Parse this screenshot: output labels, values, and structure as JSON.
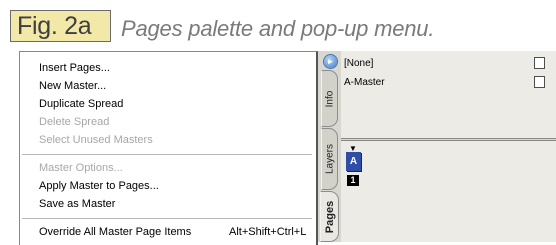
{
  "figure": {
    "tag": "Fig. 2a",
    "caption": "Pages palette and pop-up menu."
  },
  "menu": {
    "items": [
      {
        "label": "Insert Pages...",
        "enabled": true
      },
      {
        "label": "New Master...",
        "enabled": true
      },
      {
        "label": "Duplicate Spread",
        "enabled": true
      },
      {
        "label": "Delete Spread",
        "enabled": false
      },
      {
        "label": "Select Unused Masters",
        "enabled": false
      },
      {
        "label": "Master Options...",
        "enabled": false
      },
      {
        "label": "Apply Master to Pages...",
        "enabled": true
      },
      {
        "label": "Save as Master",
        "enabled": true
      },
      {
        "label": "Override All Master Page Items",
        "enabled": true,
        "shortcut": "Alt+Shift+Ctrl+L"
      }
    ]
  },
  "palette": {
    "tabs": [
      {
        "label": "Info",
        "active": false
      },
      {
        "label": "Layers",
        "active": false
      },
      {
        "label": "Pages",
        "active": true
      }
    ],
    "masters": [
      {
        "label": "[None]"
      },
      {
        "label": "A-Master"
      }
    ],
    "page": {
      "prefix": "A",
      "number": "1"
    },
    "menu_button_icon": "play-triangle-icon",
    "colors": {
      "page_thumb": "#2f4fa6",
      "palette_bg": "#d8d7d0",
      "caption_tag_bg": "#f2e8a8"
    }
  }
}
